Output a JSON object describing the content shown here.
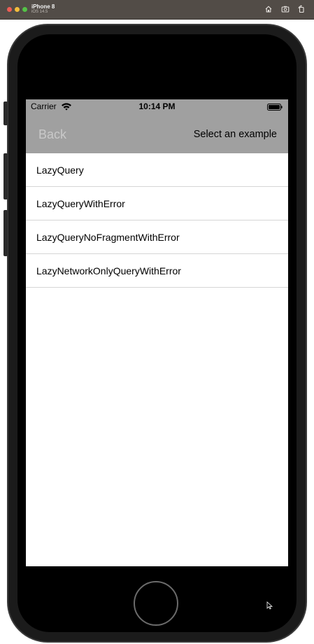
{
  "simulator": {
    "device_name": "iPhone 8",
    "os_version": "iOS 14.5",
    "icons": [
      "home-icon",
      "screenshot-icon",
      "rotate-icon"
    ]
  },
  "status_bar": {
    "carrier": "Carrier",
    "time": "10:14 PM"
  },
  "nav_bar": {
    "back_label": "Back",
    "title": "Select an example"
  },
  "list": {
    "items": [
      {
        "label": "LazyQuery"
      },
      {
        "label": "LazyQueryWithError"
      },
      {
        "label": "LazyQueryNoFragmentWithError"
      },
      {
        "label": "LazyNetworkOnlyQueryWithError"
      }
    ]
  },
  "colors": {
    "nav_background": "#a0a0a0",
    "back_label": "#c9c9c9",
    "separator": "#d6d6d6",
    "simulator_titlebar": "#524c47"
  }
}
